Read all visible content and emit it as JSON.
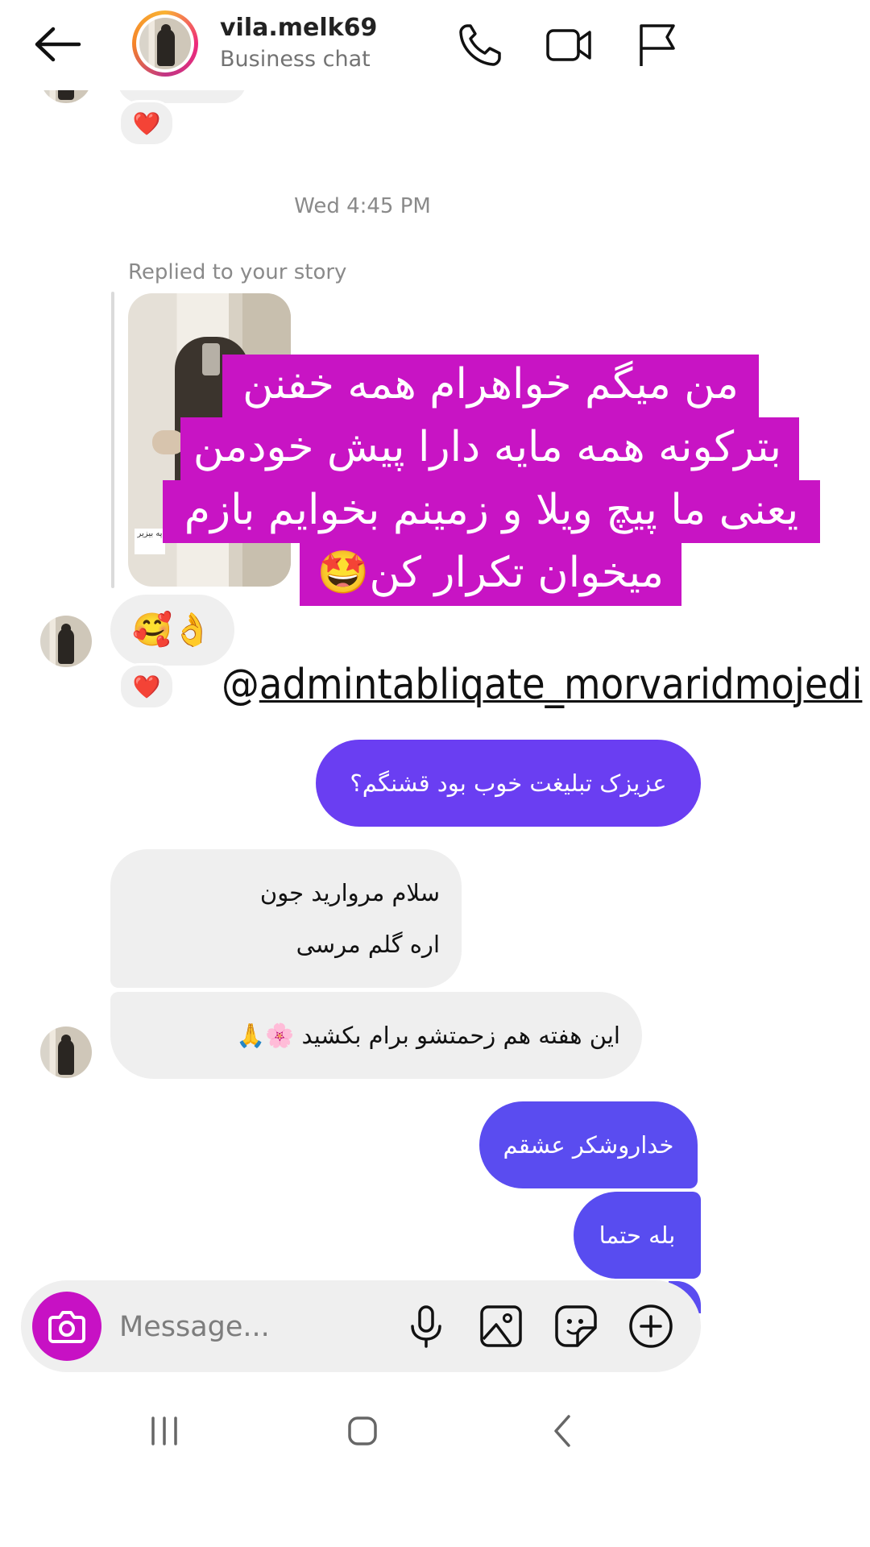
{
  "header": {
    "username": "vila.melk69",
    "subtitle": "Business chat",
    "icons": [
      "back-arrow-icon",
      "phone-icon",
      "video-icon",
      "flag-icon"
    ]
  },
  "thread": {
    "reaction_heart": "❤️",
    "timestamp": "Wed 4:45 PM",
    "story_reply_label": "Replied to your story",
    "story_sticker_text": "په بیزیر",
    "story_overlay_lines": [
      "من میگم خواهرام همه خفنن",
      "بترکونه همه مایه دارا پیش خودمن",
      "یعنی ما پیچ ویلا و زمینم بخوایم بازم",
      "میخوان تکرار کن🤩"
    ],
    "story_mention_at": "@",
    "story_mention_name": "admintabliqate_morvaridmojedi",
    "reply_emoji": "👌🥰",
    "messages": [
      {
        "from": "me",
        "text": "عزیزک تبلیغت خوب بود قشنگم؟"
      },
      {
        "from": "them",
        "text_line1": "سلام مروارید جون",
        "text_line2": "اره گلم مرسی"
      },
      {
        "from": "them",
        "text": "این هفته هم زحمتشو برام بکشید 🌸🙏"
      },
      {
        "from": "me",
        "text": "خداروشکر عشقم"
      },
      {
        "from": "me",
        "text": "بله حتما"
      }
    ]
  },
  "composer": {
    "placeholder": "Message...",
    "icons": [
      "camera-icon",
      "microphone-icon",
      "gallery-icon",
      "sticker-icon",
      "plus-icon"
    ]
  },
  "colors": {
    "outgoing_bubble": "#6a3ef2",
    "outgoing_bubble_alt": "#5a4cf0",
    "incoming_bubble": "#efefef",
    "overlay_magenta": "#c814c4",
    "camera_button": "#c711c4"
  },
  "navbar": {
    "icons": [
      "recent-apps-icon",
      "home-icon",
      "back-icon"
    ]
  }
}
